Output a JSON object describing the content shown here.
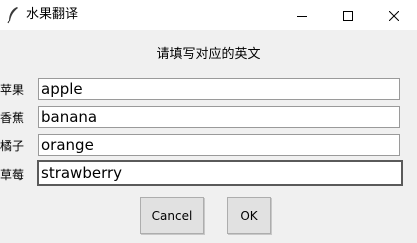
{
  "window": {
    "title": "水果翻译",
    "icons": {
      "app": "feather-icon",
      "minimize": "minimize-icon",
      "maximize": "maximize-icon",
      "close": "close-icon"
    }
  },
  "prompt": "请填写对应的英文",
  "rows": [
    {
      "label": "苹果",
      "value": "apple"
    },
    {
      "label": "香蕉",
      "value": "banana"
    },
    {
      "label": "橘子",
      "value": "orange"
    },
    {
      "label": "草莓",
      "value": "strawberry"
    }
  ],
  "buttons": {
    "cancel": "Cancel",
    "ok": "OK"
  }
}
